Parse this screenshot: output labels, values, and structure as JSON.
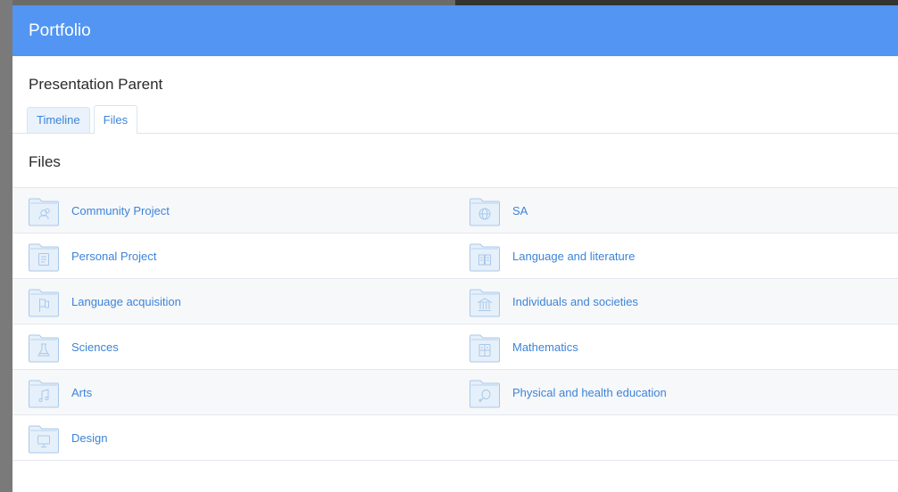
{
  "header": {
    "title": "Portfolio"
  },
  "page": {
    "subtitle": "Presentation Parent"
  },
  "tabs": [
    {
      "label": "Timeline",
      "active": false
    },
    {
      "label": "Files",
      "active": true
    }
  ],
  "files_section": {
    "title": "Files"
  },
  "folders": {
    "left": [
      {
        "label": "Community Project",
        "icon": "community-icon"
      },
      {
        "label": "Personal Project",
        "icon": "document-icon"
      },
      {
        "label": "Language acquisition",
        "icon": "flag-icon"
      },
      {
        "label": "Sciences",
        "icon": "flask-icon"
      },
      {
        "label": "Arts",
        "icon": "music-note-icon"
      },
      {
        "label": "Design",
        "icon": "monitor-icon"
      }
    ],
    "right": [
      {
        "label": "SA",
        "icon": "globe-icon"
      },
      {
        "label": "Language and literature",
        "icon": "book-icon"
      },
      {
        "label": "Individuals and societies",
        "icon": "institution-icon"
      },
      {
        "label": "Mathematics",
        "icon": "calculator-icon"
      },
      {
        "label": "Physical and health education",
        "icon": "racket-icon"
      }
    ]
  },
  "colors": {
    "header_bg": "#5295f3",
    "link": "#3c84d8",
    "folder_fill": "#e6f0fa",
    "folder_stroke": "#a9c8ea"
  }
}
